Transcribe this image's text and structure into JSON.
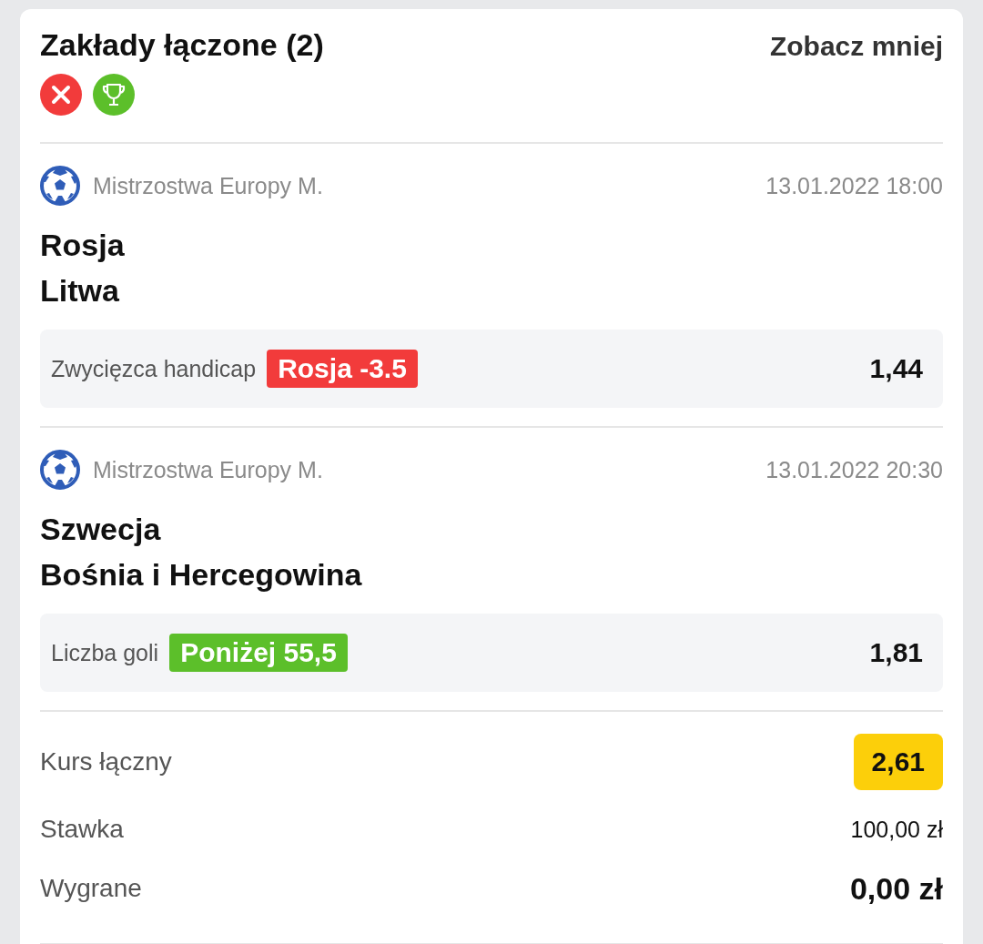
{
  "header": {
    "title": "Zakłady łączone (2)",
    "toggle": "Zobacz mniej",
    "status_icons": [
      {
        "kind": "lost"
      },
      {
        "kind": "won"
      }
    ]
  },
  "bets": [
    {
      "league": "Mistrzostwa Europy M.",
      "datetime": "13.01.2022 18:00",
      "teams": [
        "Rosja",
        "Litwa"
      ],
      "market": "Zwycięzca handicap",
      "pick": "Rosja -3.5",
      "color": "#f23b3b",
      "odds": "1,44"
    },
    {
      "league": "Mistrzostwa Europy M.",
      "datetime": "13.01.2022 20:30",
      "teams": [
        "Szwecja",
        "Bośnia i Hercegowina"
      ],
      "market": "Liczba goli",
      "pick": "Poniżej 55,5",
      "color": "#5cbf2a",
      "odds": "1,81"
    }
  ],
  "summary": {
    "total_odds_label": "Kurs łączny",
    "total_odds": "2,61",
    "stake_label": "Stawka",
    "stake": "100,00 zł",
    "winnings_label": "Wygrane",
    "winnings": "0,00 zł"
  }
}
